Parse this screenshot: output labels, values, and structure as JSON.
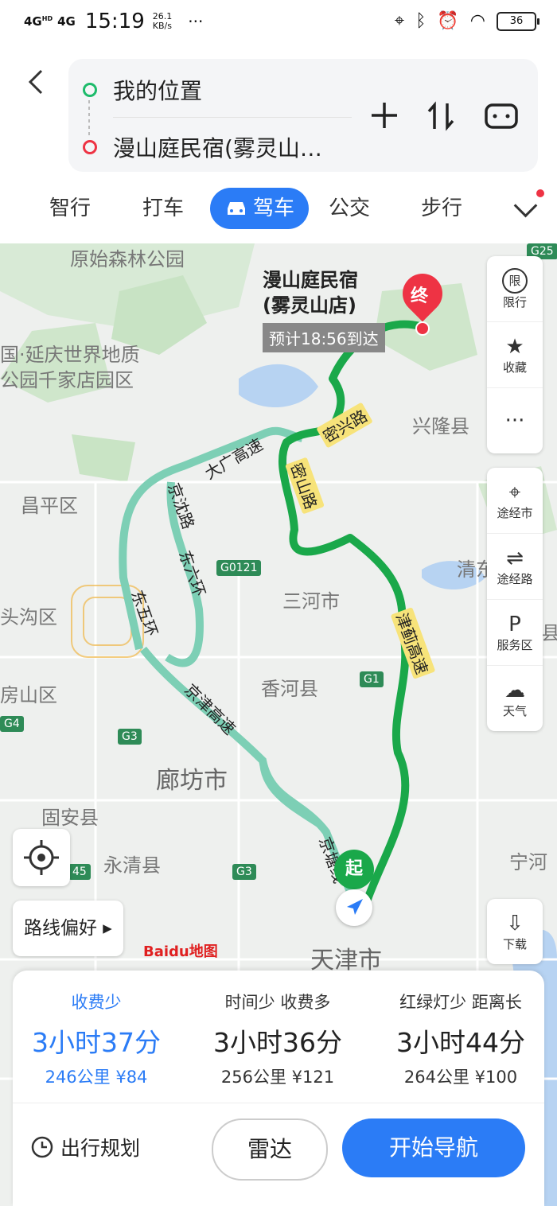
{
  "status_bar": {
    "signal1": "4G",
    "signal1_sup": "HD",
    "signal2": "4G",
    "time": "15:19",
    "net_speed": "26.1",
    "net_unit": "KB/s",
    "more": "···",
    "battery": "36"
  },
  "route": {
    "from": "我的位置",
    "to": "漫山庭民宿(雾灵山…"
  },
  "tabs": [
    "智行",
    "打车",
    "驾车",
    "公交",
    "步行"
  ],
  "map": {
    "dest_name_line1": "漫山庭民宿",
    "dest_name_line2": "(雾灵山店)",
    "eta": "预计18:56到达",
    "end_pin": "终",
    "start_pin": "起",
    "labels": [
      "原始森林公园",
      "国·延庆世界地质",
      "公园千家店园区",
      "兴隆县",
      "昌平区",
      "三河市",
      "头沟区",
      "香河县",
      "房山区",
      "廊坊市",
      "固安县",
      "永清县",
      "宁河",
      "天津市",
      "清东",
      "县"
    ],
    "road_labels": [
      "密兴路",
      "密山路",
      "大广高速",
      "京沈路",
      "东六环",
      "东五环",
      "津蓟高速",
      "京津高速",
      "京塘线"
    ],
    "shields": [
      "G0121",
      "G1",
      "G3",
      "G3",
      "G4",
      "G25",
      "45"
    ],
    "baidu": "Baidu地图"
  },
  "side_panel_top": [
    {
      "icon": "限",
      "label": "限行"
    },
    {
      "icon": "★",
      "label": "收藏"
    },
    {
      "icon": "···",
      "label": ""
    }
  ],
  "side_panel_mid": [
    {
      "label": "途经市"
    },
    {
      "label": "途经路"
    },
    {
      "label": "服务区"
    },
    {
      "label": "天气"
    }
  ],
  "download": {
    "label": "下载"
  },
  "pref_button": "路线偏好 ▸",
  "routes": [
    {
      "tag": "收费少",
      "duration": "3小时37分",
      "meta": "246公里  ¥84"
    },
    {
      "tag": "时间少  收费多",
      "duration": "3小时36分",
      "meta": "256公里  ¥121"
    },
    {
      "tag": "红绿灯少  距离长",
      "duration": "3小时44分",
      "meta": "264公里  ¥100"
    }
  ],
  "actions": {
    "plan": "出行规划",
    "radar": "雷达",
    "start": "开始导航"
  },
  "colors": {
    "accent": "#2b7cf6",
    "route_green": "#1aa84a",
    "alt_route": "#7dcfb5"
  }
}
